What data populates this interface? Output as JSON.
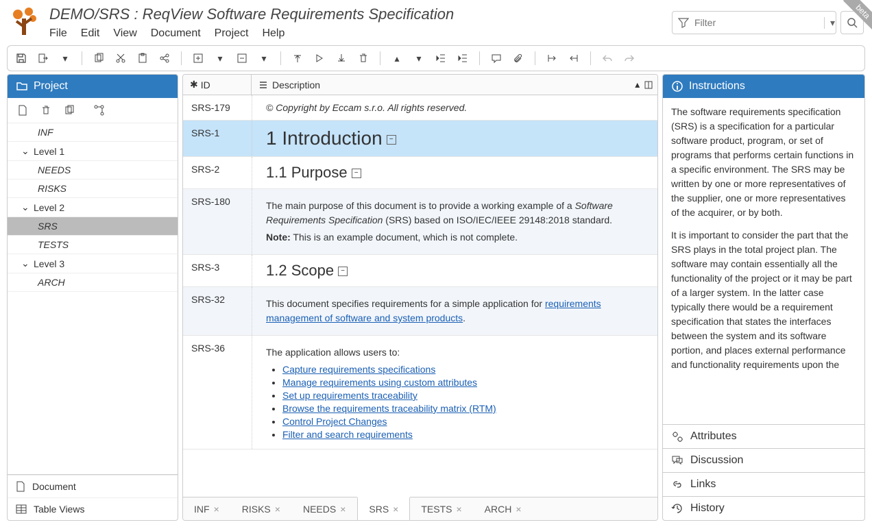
{
  "beta": "beta",
  "title": "DEMO/SRS : ReqView Software Requirements Specification",
  "menu": {
    "file": "File",
    "edit": "Edit",
    "view": "View",
    "document": "Document",
    "project": "Project",
    "help": "Help"
  },
  "filter": {
    "placeholder": "Filter"
  },
  "project": {
    "header": "Project",
    "tree": [
      {
        "label": "INF",
        "level": 2,
        "italic": true
      },
      {
        "label": "Level 1",
        "level": 1,
        "chev": true
      },
      {
        "label": "NEEDS",
        "level": 2,
        "italic": true
      },
      {
        "label": "RISKS",
        "level": 2,
        "italic": true
      },
      {
        "label": "Level 2",
        "level": 1,
        "chev": true
      },
      {
        "label": "SRS",
        "level": 2,
        "italic": true,
        "selected": true
      },
      {
        "label": "TESTS",
        "level": 2,
        "italic": true
      },
      {
        "label": "Level 3",
        "level": 1,
        "chev": true
      },
      {
        "label": "ARCH",
        "level": 2,
        "italic": true
      }
    ],
    "footer": {
      "document": "Document",
      "tableviews": "Table Views"
    }
  },
  "columns": {
    "id": "ID",
    "description": "Description"
  },
  "rows": {
    "r0": {
      "id": "SRS-179",
      "copyright": "© Copyright by Eccam s.r.o. All rights reserved."
    },
    "r1": {
      "id": "SRS-1",
      "heading": "1 Introduction"
    },
    "r2": {
      "id": "SRS-2",
      "heading": "1.1 Purpose"
    },
    "r3": {
      "id": "SRS-180",
      "p1a": "The main purpose of this document is to provide a working example of a ",
      "p1b": "Software Requirements Specification",
      "p1c": " (SRS) based on ISO/IEC/IEEE 29148:2018 standard.",
      "note_label": "Note:",
      "note": " This is an example document, which is not complete."
    },
    "r4": {
      "id": "SRS-3",
      "heading": "1.2 Scope"
    },
    "r5": {
      "id": "SRS-32",
      "pre": "This document specifies requirements for a simple application for ",
      "link": "requirements management of software and system products",
      "post": "."
    },
    "r6": {
      "id": "SRS-36",
      "intro": "The application allows users to:",
      "items": [
        "Capture requirements specifications",
        "Manage requirements using custom attributes",
        "Set up requirements traceability",
        "Browse the requirements traceability matrix (RTM)",
        "Control Project Changes",
        "Filter and search requirements"
      ]
    }
  },
  "tabs": [
    "INF",
    "RISKS",
    "NEEDS",
    "SRS",
    "TESTS",
    "ARCH"
  ],
  "activeTab": "SRS",
  "instructions": {
    "header": "Instructions",
    "p1": "The software requirements specification (SRS) is a specification for a particular software product, program, or set of programs that performs certain functions in a specific environment. The SRS may be written by one or more representatives of the supplier, one or more representatives of the acquirer, or by both.",
    "p2": "It is important to consider the part that the SRS plays in the total project plan. The software may contain essentially all the functionality of the project or it may be part of a larger system. In the latter case typically there would be a requirement specification that states the interfaces between the system and its software portion, and places external performance and functionality requirements upon the"
  },
  "accordion": {
    "attributes": "Attributes",
    "discussion": "Discussion",
    "links": "Links",
    "history": "History"
  }
}
